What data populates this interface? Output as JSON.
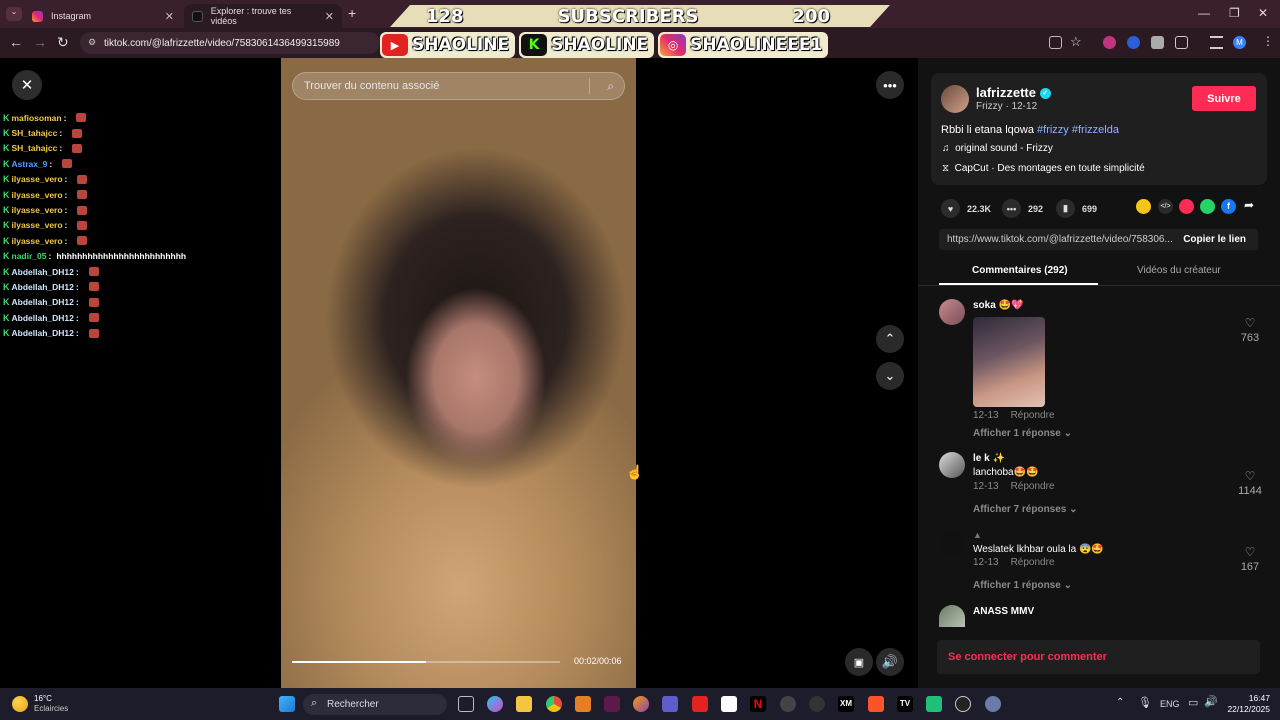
{
  "browser": {
    "tabs": [
      {
        "label": "Instagram",
        "close": "✕"
      },
      {
        "label": "Explorer : trouve tes vidéos",
        "close": "✕"
      }
    ],
    "new_tab": "+",
    "url": "tiktok.com/@lafrizzette/video/7583061436499315989",
    "window_controls": [
      "—",
      "❐",
      "✕"
    ]
  },
  "overlay": {
    "count_left": "128",
    "label": "SUBSCRIBERS",
    "count_right": "200",
    "handles": [
      {
        "platform": "youtube",
        "name": "SHAOLINE"
      },
      {
        "platform": "kick",
        "name": "SHAOLINE"
      },
      {
        "platform": "instagram",
        "name": "SHAOLINEEE1"
      }
    ]
  },
  "chat": [
    {
      "user": "mafiosoman",
      "color": "#f2c94c",
      "msg": ""
    },
    {
      "user": "SH_tahajcc",
      "color": "#f2c94c",
      "msg": ""
    },
    {
      "user": "SH_tahajcc",
      "color": "#f2c94c",
      "msg": ""
    },
    {
      "user": "Astrax_9",
      "color": "#4aa3ff",
      "msg": ""
    },
    {
      "user": "ilyasse_vero",
      "color": "#f2c94c",
      "msg": ""
    },
    {
      "user": "ilyasse_vero",
      "color": "#f2c94c",
      "msg": ""
    },
    {
      "user": "ilyasse_vero",
      "color": "#f2c94c",
      "msg": ""
    },
    {
      "user": "ilyasse_vero",
      "color": "#f2c94c",
      "msg": ""
    },
    {
      "user": "ilyasse_vero",
      "color": "#f2c94c",
      "msg": ""
    },
    {
      "user": "nadir_05",
      "color": "#42d96b",
      "msg": "hhhhhhhhhhhhhhhhhhhhhhhhh"
    },
    {
      "user": "Abdellah_DH12",
      "color": "#cfe9ff",
      "msg": ""
    },
    {
      "user": "Abdellah_DH12",
      "color": "#cfe9ff",
      "msg": ""
    },
    {
      "user": "Abdellah_DH12",
      "color": "#cfe9ff",
      "msg": ""
    },
    {
      "user": "Abdellah_DH12",
      "color": "#cfe9ff",
      "msg": ""
    },
    {
      "user": "Abdellah_DH12",
      "color": "#cfe9ff",
      "msg": ""
    }
  ],
  "player": {
    "search_placeholder": "Trouver du contenu associé",
    "time": "00:02/00:06",
    "progress": 0.5
  },
  "author": {
    "username": "lafrizzette",
    "nickname": "Frizzy",
    "date": "12-12",
    "follow": "Suivre",
    "caption": "Rbbi li etana lqowa",
    "hashtags": "#frizzy #frizzelda",
    "sound": "original sound - Frizzy",
    "capcut": "CapCut · Des montages en toute simplicité"
  },
  "stats": {
    "likes": "22.3K",
    "comments": "292",
    "saves": "699"
  },
  "link": {
    "url": "https://www.tiktok.com/@lafrizzette/video/758306...",
    "copy": "Copier le lien"
  },
  "panel_tabs": [
    "Commentaires (292)",
    "Vidéos du créateur"
  ],
  "comments": [
    {
      "name": "soka 🤩💖",
      "text": "",
      "date": "12-13",
      "reply": "Répondre",
      "more": "Afficher 1 réponse ⌄",
      "likes": "763"
    },
    {
      "name": "le k ✨",
      "text": "lanchoba🤩🤩",
      "date": "12-13",
      "reply": "Répondre",
      "more": "Afficher 7 réponses ⌄",
      "likes": "1144"
    },
    {
      "name": "",
      "text": "Weslatek lkhbar oula la 😨🤩",
      "date": "12-13",
      "reply": "Répondre",
      "more": "Afficher 1 réponse ⌄",
      "likes": "167"
    },
    {
      "name": "ANASS MMV",
      "text": "",
      "date": "",
      "reply": "",
      "more": "",
      "likes": ""
    }
  ],
  "login_prompt": "Se connecter pour commenter",
  "taskbar": {
    "weather_temp": "16°C",
    "weather_desc": "Eclaircies",
    "search": "Rechercher",
    "lang": "ENG",
    "time": "16:47",
    "date": "22/12/2025"
  },
  "colors": {
    "accent": "#fe2c55",
    "tab_bg": "#3a1f2c",
    "panel_bg": "#121212"
  }
}
